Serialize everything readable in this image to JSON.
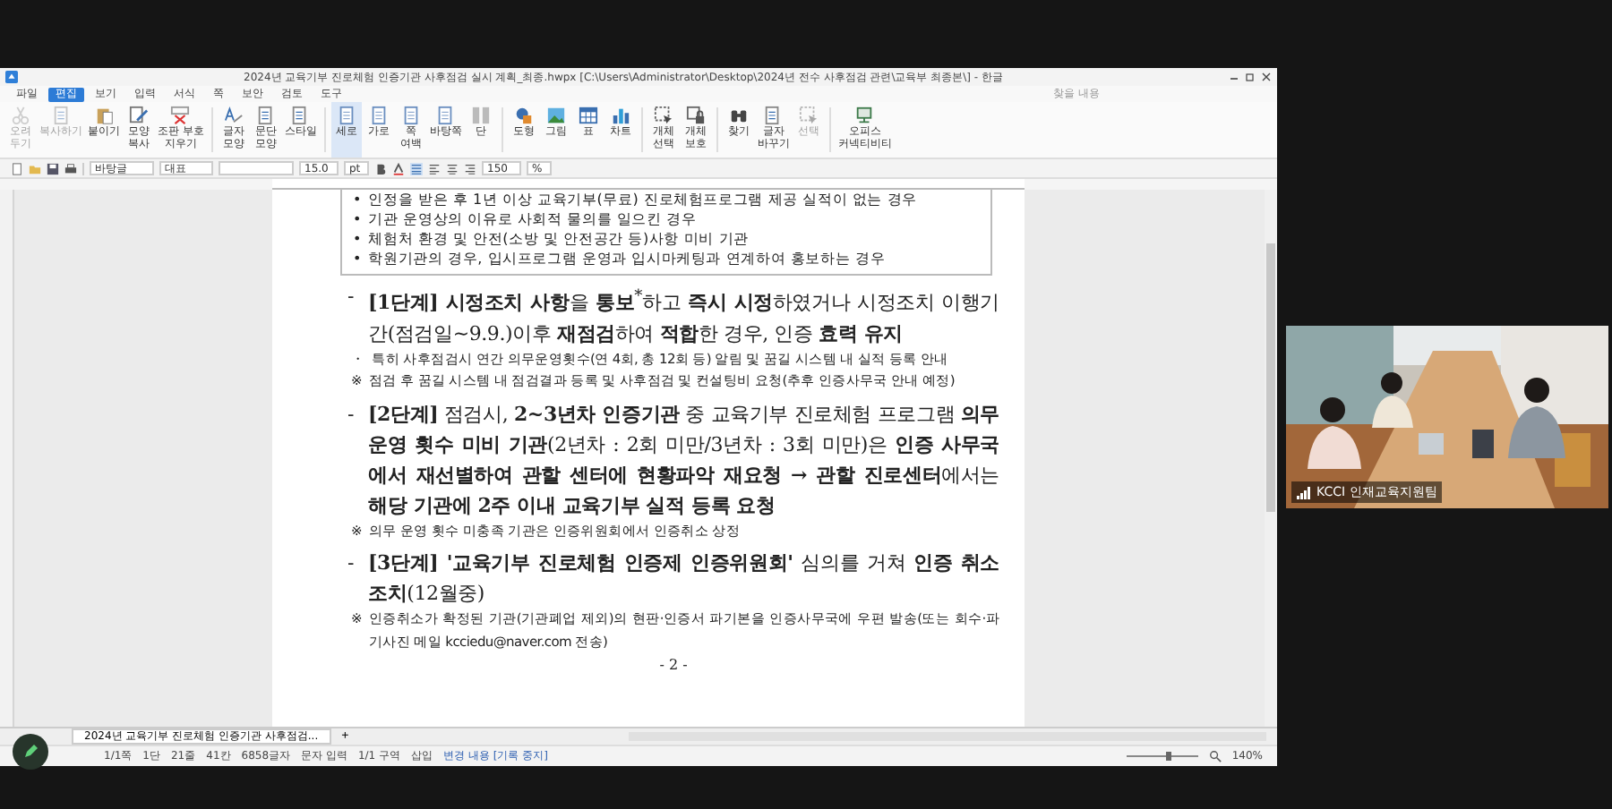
{
  "window": {
    "title": "2024년 교육기부 진로체험 인증기관 사후점검 실시 계획_최종.hwpx [C:\\Users\\Administrator\\Desktop\\2024년 전수 사후점검 관련\\교육부 최종본\\] - 한글"
  },
  "menu": [
    {
      "label": "파일",
      "selected": false
    },
    {
      "label": "편집",
      "selected": true
    },
    {
      "label": "보기",
      "selected": false
    },
    {
      "label": "입력",
      "selected": false
    },
    {
      "label": "서식",
      "selected": false
    },
    {
      "label": "쪽",
      "selected": false
    },
    {
      "label": "보안",
      "selected": false
    },
    {
      "label": "검토",
      "selected": false
    },
    {
      "label": "도구",
      "selected": false
    }
  ],
  "search": {
    "placeholder": "찾을 내용"
  },
  "ribbon": [
    {
      "label": "오려\n두기",
      "disabled": true
    },
    {
      "label": "복사하기",
      "disabled": true
    },
    {
      "label": "붙이기",
      "disabled": false
    },
    {
      "label": "모양\n복사",
      "disabled": false
    },
    {
      "label": "조판 부호\n지우기",
      "disabled": false
    },
    {
      "label": "글자\n모양",
      "disabled": false
    },
    {
      "label": "문단\n모양",
      "disabled": false
    },
    {
      "label": "스타일",
      "disabled": false
    },
    {
      "label": "세로",
      "disabled": false,
      "selected": true
    },
    {
      "label": "가로",
      "disabled": false,
      "selected": false
    },
    {
      "label": "쪽\n여백",
      "disabled": false
    },
    {
      "label": "바탕쪽",
      "disabled": false
    },
    {
      "label": "단",
      "disabled": false
    },
    {
      "label": "도형",
      "disabled": false
    },
    {
      "label": "그림",
      "disabled": false
    },
    {
      "label": "표",
      "disabled": false
    },
    {
      "label": "차트",
      "disabled": false
    },
    {
      "label": "개체\n선택",
      "disabled": false
    },
    {
      "label": "개체\n보호",
      "disabled": false
    },
    {
      "label": "찾기",
      "disabled": false
    },
    {
      "label": "글자\n바꾸기",
      "disabled": false
    },
    {
      "label": "선택",
      "disabled": true
    },
    {
      "label": "오피스\n커넥티비티",
      "disabled": false
    }
  ],
  "format_bar": {
    "style": "바탕글",
    "language": "대표",
    "font_size": "15.0",
    "size_unit": "pt",
    "zoom": "150",
    "zoom_unit": "%"
  },
  "document": {
    "paragraphs": [
      {
        "kind": "bullet",
        "marker": "•",
        "text": "인정을 받은 후 1년 이상 교육기부(무료) 진로체험프로그램 제공 실적이 없는 경우"
      },
      {
        "kind": "bullet",
        "marker": "•",
        "text": "기관 운영상의 이유로 사회적 물의를 일으킨 경우"
      },
      {
        "kind": "bullet",
        "marker": "•",
        "text": "체험처 환경 및 안전(소방 및 안전공간 등)사항 미비 기관"
      },
      {
        "kind": "bullet",
        "marker": "•",
        "text": "학원기관의 경우, 입시프로그램 운영과 입시마케팅과 연계하여 홍보하는 경우"
      },
      {
        "kind": "step",
        "marker": "-",
        "text": "**[1단계] 시정조치 사항**을 **통보**$^{*}$하고 **즉시 시정**하였거나 시정조치 이행기간(점검일~9.9.)이후 **재점검**하여 **적합**한 경우, 인증 **효력 유지**"
      },
      {
        "kind": "note",
        "marker": "・",
        "text": "특히 사후점검시 연간 의무운영횟수(연 4회, 총 12회 등) 알림 및 꿈길 시스템 내 실적 등록 안내"
      },
      {
        "kind": "note",
        "marker": "※",
        "text": "점검 후 꿈길 시스템 내 점검결과 등록 및 사후점검 및 컨설팅비 요청(추후 인증사무국 안내 예정)"
      },
      {
        "kind": "step",
        "marker": "-",
        "text": "**[2단계]** 점검시, **2~3년차 인증기관** 중 교육기부 진로체험 프로그램 **의무 운영 횟수 미비 기관**(2년차 : 2회 미만/3년차 : 3회 미만)은 **인증 사무국에서 재선별하여 관할 센터에 현황파악 재요청 → 관할 진로센터**에서는 **해당 기관에 2주 이내 교육기부 실적 등록 요청**"
      },
      {
        "kind": "note",
        "marker": "※",
        "text": "의무 운영 횟수 미충족 기관은 인증위원회에서 인증취소 상정"
      },
      {
        "kind": "step",
        "marker": "-",
        "text": "**[3단계] '교육기부 진로체험 인증제 인증위원회'** 심의를 거쳐 **인증 취소 조치**(12월중)"
      },
      {
        "kind": "note",
        "marker": "※",
        "text": "인증취소가 확정된 기관(기관폐업 제외)의 현판·인증서 파기본을 인증사무국에 우편 발송(또는 회수·파기사진 메일 kcciedu@naver.com 전송)"
      },
      {
        "kind": "page_number",
        "text": "- 2 -"
      }
    ]
  },
  "doc_tab": {
    "label": "2024년 교육기부 진로체험 인증기관 사후점검...",
    "add": "+"
  },
  "status_bar": [
    "1/1쪽",
    "1단",
    "21줄",
    "41칸",
    "6858글자",
    "문자 입력",
    "1/1 구역",
    "삽입",
    "변경 내용 [기록 중지]"
  ],
  "zoom_level": "140%",
  "zoom_slider": {
    "level": 0.6
  },
  "video": {
    "name": "KCCI 인재교육지원팀"
  }
}
